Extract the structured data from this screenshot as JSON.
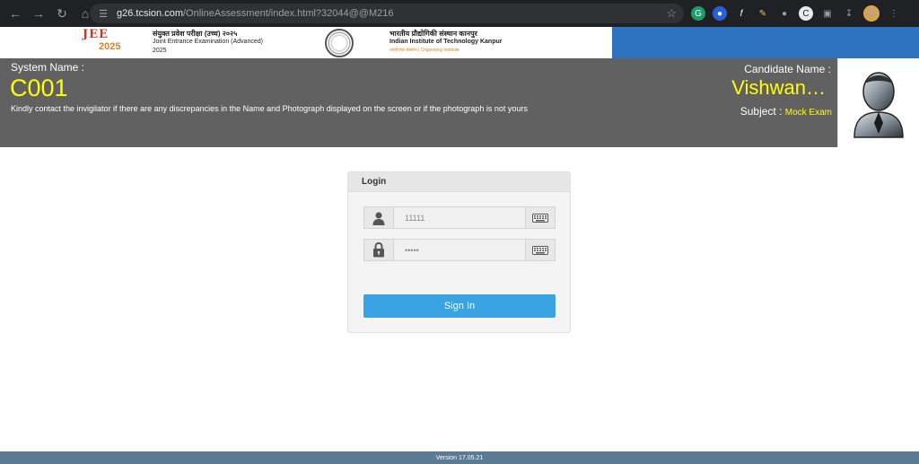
{
  "browser": {
    "url_host": "g26.tcsion.com",
    "url_path": "/OnlineAssessment/index.html?32044@@M216",
    "icons": [
      "back-icon",
      "forward-icon",
      "reload-icon",
      "home-icon",
      "site-info-icon",
      "bookmark-star-icon",
      "download-icon"
    ]
  },
  "banner": {
    "jee_logo": "JEE",
    "jee_year": "2025",
    "exam_hindi": "संयुक्त प्रवेश परीक्षा (उच्च) २०२५",
    "exam_english": "Joint Entrance Examination (Advanced)",
    "exam_year": "2025",
    "institute_hindi": "भारतीय प्रौद्योगिकी संस्थान कानपुर",
    "institute_english": "Indian Institute of Technology Kanpur",
    "institute_org": "आयोजक संस्थान | Organising Institute"
  },
  "header": {
    "system_label": "System Name :",
    "system_value": "C001",
    "notice": "Kindly contact the invigilator if there are any discrepancies in the Name and Photograph displayed on the screen or if the photograph is not yours",
    "candidate_label": "Candidate Name :",
    "candidate_value": "Vishwan…",
    "subject_label": "Subject :",
    "subject_value": "Mock Exam"
  },
  "login": {
    "title": "Login",
    "username_value": "11111",
    "password_value": "•••••",
    "signin_label": "Sign In"
  },
  "footer": {
    "version": "Version 17.05.21"
  },
  "colors": {
    "header_bg": "#616161",
    "highlight": "#ffff00",
    "signin_bg": "#3aa3e3",
    "banner_blue": "#2f73c0",
    "footer_bg": "#5b7a93"
  }
}
